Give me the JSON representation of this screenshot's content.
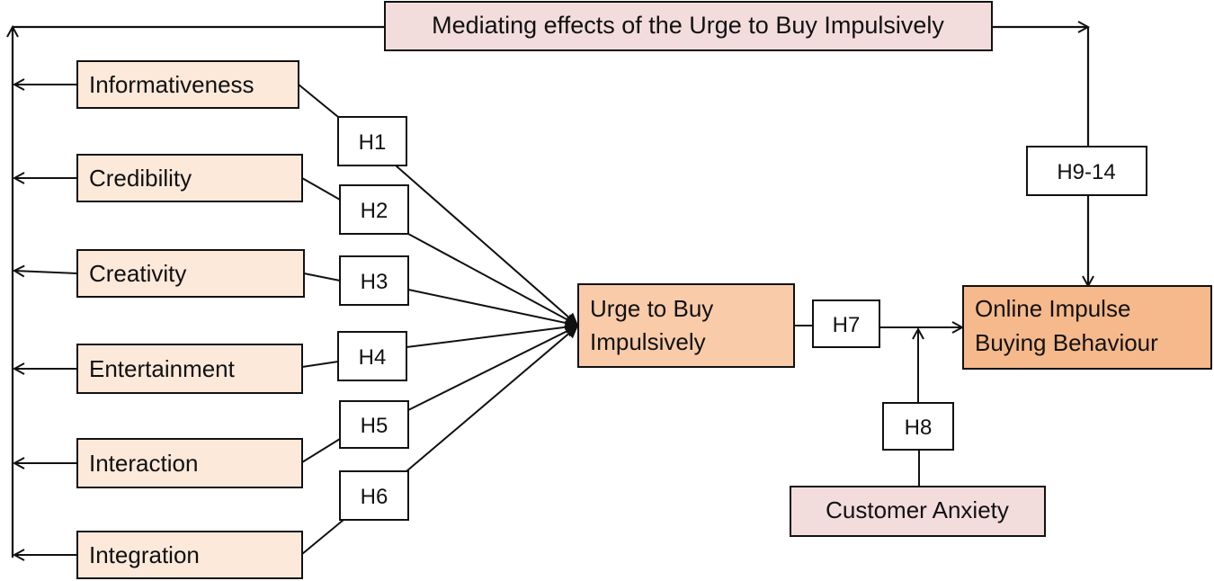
{
  "title_box": {
    "label": "Mediating effects of the Urge to Buy Impulsively"
  },
  "independent_variables": [
    {
      "label": "Informativeness",
      "hypothesis": "H1"
    },
    {
      "label": "Credibility",
      "hypothesis": "H2"
    },
    {
      "label": "Creativity",
      "hypothesis": "H3"
    },
    {
      "label": "Entertainment",
      "hypothesis": "H4"
    },
    {
      "label": "Interaction",
      "hypothesis": "H5"
    },
    {
      "label": "Integration",
      "hypothesis": "H6"
    }
  ],
  "mediator": {
    "label_line1": "Urge to Buy",
    "label_line2": "Impulsively"
  },
  "outcome": {
    "label_line1": "Online Impulse",
    "label_line2": "Buying Behaviour"
  },
  "moderator": {
    "label": "Customer Anxiety"
  },
  "hypotheses": {
    "mediator_to_outcome": "H7",
    "moderation": "H8",
    "mediation": "H9-14"
  },
  "colors": {
    "independent_fill": "#fce9da",
    "mediator_fill": "#f9cba9",
    "outcome_fill": "#f6b98b",
    "pink_fill": "#f3dcdc",
    "hyp_fill": "#ffffff",
    "stroke": "#111111"
  }
}
